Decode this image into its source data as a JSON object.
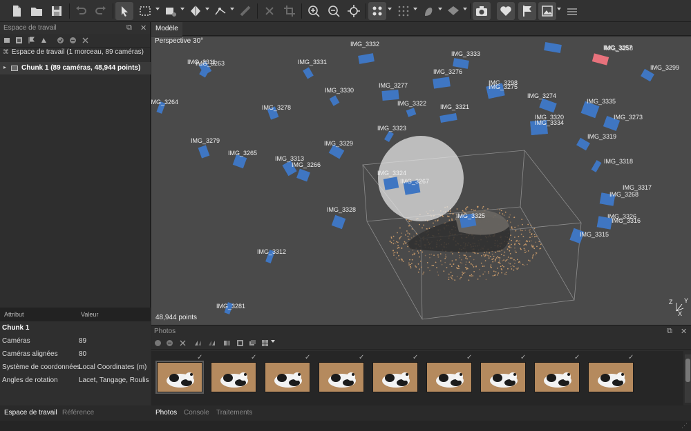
{
  "toolbar": {
    "icons": [
      "new-doc-icon",
      "open-folder-icon",
      "save-icon",
      "undo-icon",
      "redo-icon",
      "pointer-icon",
      "rect-select-icon",
      "free-select-icon",
      "navigate-icon",
      "ruler-icon",
      "shape-icon",
      "delete-icon",
      "crop-icon",
      "zoom-in-icon",
      "zoom-out-icon",
      "reset-view-icon",
      "points-view-icon",
      "dense-view-icon",
      "model-view-icon",
      "tiled-view-icon",
      "camera-icon",
      "texture-icon",
      "marker-flag-icon",
      "ortho-icon",
      "layers-icon"
    ]
  },
  "workspace": {
    "panel_title": "Espace de travail",
    "root_label": "Espace de travail (1 morceau, 89 caméras)",
    "chunk_label": "Chunk 1 (89 caméras, 48,944 points)"
  },
  "attributes": {
    "header_attr": "Attribut",
    "header_value": "Valeur",
    "section": "Chunk 1",
    "rows": [
      {
        "name": "Caméras",
        "value": "89"
      },
      {
        "name": "Caméras alignées",
        "value": "80"
      },
      {
        "name": "Système de coordonnées",
        "value": "Local Coordinates (m)"
      },
      {
        "name": "Angles de rotation",
        "value": "Lacet, Tangage, Roulis"
      }
    ]
  },
  "left_tabs": {
    "workspace": "Espace de travail",
    "reference": "Référence"
  },
  "model": {
    "tab": "Modèle",
    "perspective": "Perspective 30°",
    "points": "48,944 points",
    "axes": {
      "z": "Z",
      "y": "Y",
      "x": "X"
    },
    "colors": {
      "camera": "#3f76c2",
      "selected_camera": "#e8727c",
      "background": "#4a4a4a",
      "sphere": "#e0e0e0"
    },
    "cameras": [
      {
        "label": "IMG_3311"
      },
      {
        "label": "IMG_3263"
      },
      {
        "label": "IMG_3331"
      },
      {
        "label": "IMG_3332"
      },
      {
        "label": "IMG_3333"
      },
      {
        "label": "IMG_3276"
      },
      {
        "label": "IMG_3298"
      },
      {
        "label": "IMG_3275"
      },
      {
        "label": "IMG_3258"
      },
      {
        "label": "IMG_3257"
      },
      {
        "label": "IMG_3299"
      },
      {
        "label": "IMG_3264"
      },
      {
        "label": "IMG_3278"
      },
      {
        "label": "IMG_3330"
      },
      {
        "label": "IMG_3277"
      },
      {
        "label": "IMG_3322"
      },
      {
        "label": "IMG_3321"
      },
      {
        "label": "IMG_3323"
      },
      {
        "label": "IMG_3274"
      },
      {
        "label": "IMG_3335"
      },
      {
        "label": "IMG_3320"
      },
      {
        "label": "IMG_3334"
      },
      {
        "label": "IMG_3273"
      },
      {
        "label": "IMG_3319"
      },
      {
        "label": "IMG_3279"
      },
      {
        "label": "IMG_3265"
      },
      {
        "label": "IMG_3313"
      },
      {
        "label": "IMG_3266"
      },
      {
        "label": "IMG_3329"
      },
      {
        "label": "IMG_3318"
      },
      {
        "label": "IMG_3324"
      },
      {
        "label": "IMG_3267"
      },
      {
        "label": "IMG_3317"
      },
      {
        "label": "IMG_3268"
      },
      {
        "label": "IMG_3325"
      },
      {
        "label": "IMG_3328"
      },
      {
        "label": "IMG_3326"
      },
      {
        "label": "IMG_3316"
      },
      {
        "label": "IMG_3315"
      },
      {
        "label": "IMG_3312"
      },
      {
        "label": "IMG_3281"
      }
    ]
  },
  "photos": {
    "title": "Photos",
    "count_visible": 9
  },
  "bottom_tabs": {
    "photos": "Photos",
    "console": "Console",
    "processing": "Traitements"
  }
}
